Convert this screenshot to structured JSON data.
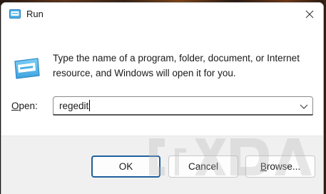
{
  "window": {
    "title": "Run",
    "close_icon": "close-icon",
    "app_icon": "run-icon"
  },
  "body": {
    "description": "Type the name of a program, folder, document, or Internet resource, and Windows will open it for you.",
    "open_label_prefix": "O",
    "open_label_rest": "pen:",
    "input_value": "regedit",
    "dropdown_icon": "chevron-down-icon"
  },
  "buttons": {
    "ok": "OK",
    "cancel": "Cancel",
    "browse_prefix": "B",
    "browse_rest": "rowse..."
  },
  "watermark": {
    "text": "XDA",
    "icon": "xda-logo"
  },
  "colors": {
    "accent": "#1f5f9e",
    "footer_bg": "#f0f0f0",
    "window_bg": "#ffffff"
  }
}
